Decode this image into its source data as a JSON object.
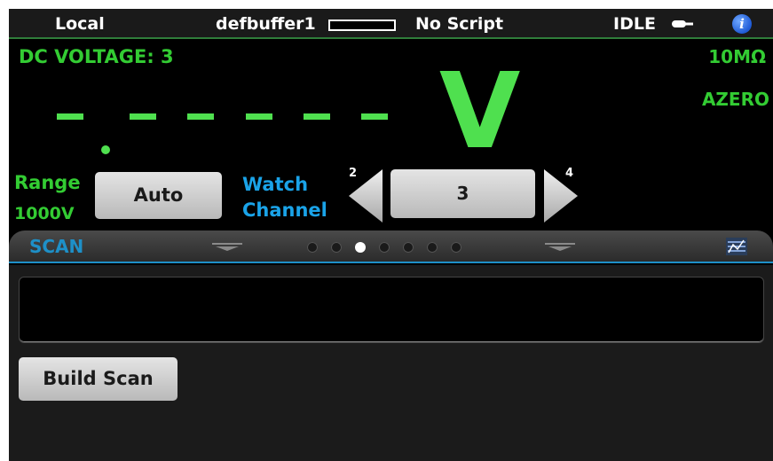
{
  "status_bar": {
    "mode": "Local",
    "buffer": "defbuffer1",
    "script": "No Script",
    "state": "IDLE",
    "info_icon": "info-icon",
    "trigger_icon": "trigger-idle-icon"
  },
  "measurement": {
    "function_label": "DC VOLTAGE: 3",
    "impedance": "10MΩ",
    "autozero": "AZERO",
    "reading_display": "- - - - - -",
    "unit": "V"
  },
  "controls": {
    "range_label": "Range",
    "range_value": "1000V",
    "range_button": "Auto",
    "watch_label_line1": "Watch",
    "watch_label_line2": "Channel",
    "prev_channel": "2",
    "channel_value": "3",
    "next_channel": "4"
  },
  "swipe_panel": {
    "title": "SCAN",
    "page_count": 7,
    "active_page": 3,
    "build_button": "Build Scan",
    "panel_icon": "scan-panel-icon"
  },
  "colors": {
    "measurement_green": "#33cc33",
    "accent_blue": "#1e90c8",
    "background": "#000000"
  }
}
